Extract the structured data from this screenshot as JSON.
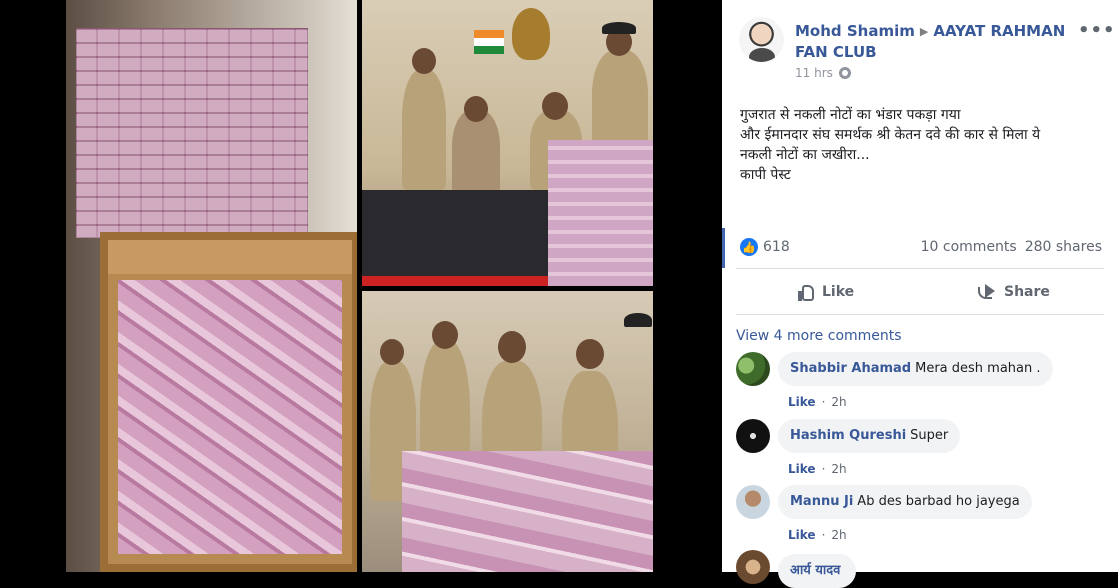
{
  "post": {
    "author": "Mohd Shamim",
    "group": "AAYAT RAHMAN FAN CLUB",
    "time": "11 hrs",
    "more_icon": "•••",
    "text_lines": [
      "गुजरात से नकली नोटों का भंडार पकड़ा गया",
      "और ईमानदार संघ समर्थक श्री केतन दवे की कार से मिला ये",
      "नकली नोटों का जखीरा...",
      "कापी पेस्ट"
    ],
    "likes": "618",
    "comments_count": "10 comments",
    "shares_count": "280 shares"
  },
  "actions": {
    "like": "Like",
    "share": "Share"
  },
  "view_more": "View 4 more comments",
  "comments": [
    {
      "author": "Shabbir Ahamad",
      "text": "Mera desh mahan .",
      "like": "Like",
      "time": "2h"
    },
    {
      "author": "Hashim Qureshi",
      "text": "Super",
      "like": "Like",
      "time": "2h"
    },
    {
      "author": "Mannu Ji",
      "text": "Ab des barbad ho jayega",
      "like": "Like",
      "time": "2h"
    },
    {
      "author": "आर्य यादव",
      "text": ""
    }
  ],
  "colors": {
    "link": "#385898",
    "accent": "#4267b2",
    "like_blue": "#1877f2"
  }
}
